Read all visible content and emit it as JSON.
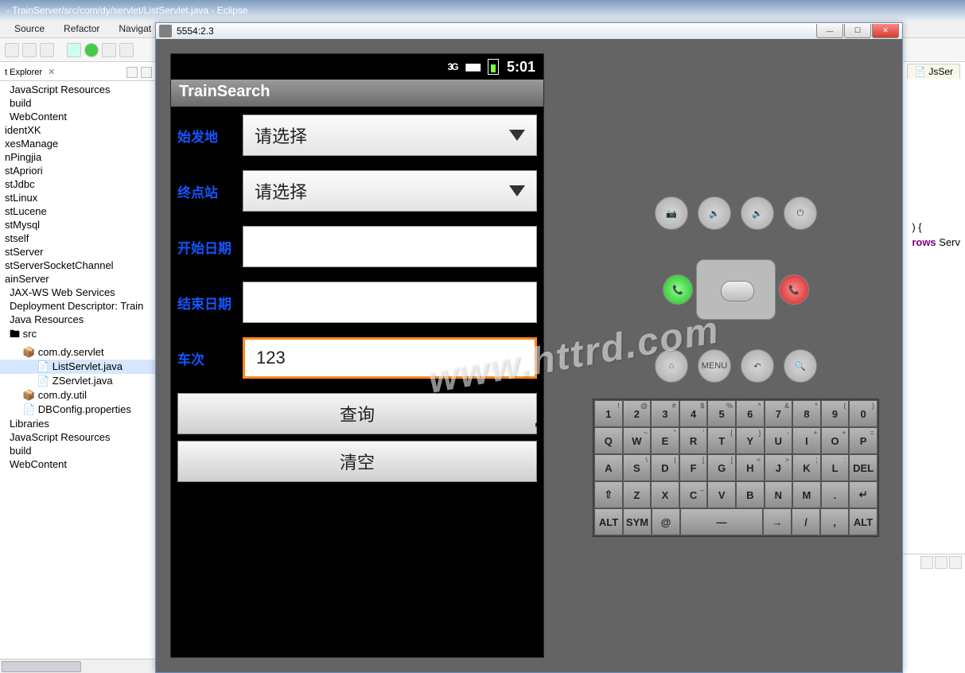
{
  "eclipse": {
    "title": "- TrainServer/src/com/dy/servlet/ListServlet.java - Eclipse",
    "menu": [
      "Source",
      "Refactor",
      "Navigat"
    ],
    "explorer_tab": "t Explorer",
    "editor_tab": "JsSer",
    "code_hint1": ") {",
    "code_hint2_kw": "rows",
    "code_hint2_rest": " Serv",
    "tree": [
      {
        "t": "JavaScript Resources",
        "cls": "in1"
      },
      {
        "t": "build",
        "cls": "in1"
      },
      {
        "t": "WebContent",
        "cls": "in1"
      },
      {
        "t": "identXK",
        "cls": ""
      },
      {
        "t": "xesManage",
        "cls": ""
      },
      {
        "t": "nPingjia",
        "cls": ""
      },
      {
        "t": "stApriori",
        "cls": ""
      },
      {
        "t": "stJdbc",
        "cls": ""
      },
      {
        "t": "stLinux",
        "cls": ""
      },
      {
        "t": "stLucene",
        "cls": ""
      },
      {
        "t": "stMysql",
        "cls": ""
      },
      {
        "t": "stself",
        "cls": ""
      },
      {
        "t": "stServer",
        "cls": ""
      },
      {
        "t": "stServerSocketChannel",
        "cls": ""
      },
      {
        "t": "ainServer",
        "cls": ""
      },
      {
        "t": "JAX-WS Web Services",
        "cls": "in1"
      },
      {
        "t": "Deployment Descriptor: Train",
        "cls": "in1"
      },
      {
        "t": "Java Resources",
        "cls": "in1"
      },
      {
        "t": "🖿 src",
        "cls": "in1"
      },
      {
        "t": "📦 com.dy.servlet",
        "cls": "in2"
      },
      {
        "t": "📄 ListServlet.java",
        "cls": "in3 sel"
      },
      {
        "t": "📄 ZServlet.java",
        "cls": "in3"
      },
      {
        "t": "📦 com.dy.util",
        "cls": "in2"
      },
      {
        "t": "📄 DBConfig.properties",
        "cls": "in2"
      },
      {
        "t": "Libraries",
        "cls": "in1"
      },
      {
        "t": "JavaScript Resources",
        "cls": "in1"
      },
      {
        "t": "build",
        "cls": "in1"
      },
      {
        "t": "WebContent",
        "cls": "in1"
      }
    ]
  },
  "emulator": {
    "title": "5554:2.3",
    "status_time": "5:01",
    "status_net": "3G",
    "app_title": "TrainSearch",
    "rows": {
      "origin_label": "始发地",
      "dest_label": "终点站",
      "start_label": "开始日期",
      "end_label": "结束日期",
      "train_label": "车次"
    },
    "spinner_placeholder": "请选择",
    "train_value": "123",
    "btn_query": "查询",
    "btn_clear": "清空"
  },
  "hw": {
    "row1": [
      "📷",
      "🔉",
      "🔊",
      "⏻"
    ],
    "dpad": {
      "call": "📞",
      "end": "📞"
    },
    "row3": [
      "⌂",
      "MENU",
      "↶",
      "🔍"
    ]
  },
  "keyboard": {
    "r1": [
      {
        "m": "1",
        "a": "!"
      },
      {
        "m": "2",
        "a": "@"
      },
      {
        "m": "3",
        "a": "#"
      },
      {
        "m": "4",
        "a": "$"
      },
      {
        "m": "5",
        "a": "%"
      },
      {
        "m": "6",
        "a": "^"
      },
      {
        "m": "7",
        "a": "&"
      },
      {
        "m": "8",
        "a": "*"
      },
      {
        "m": "9",
        "a": "("
      },
      {
        "m": "0",
        "a": ")"
      }
    ],
    "r2": [
      {
        "m": "Q",
        "a": ""
      },
      {
        "m": "W",
        "a": "~"
      },
      {
        "m": "E",
        "a": "\""
      },
      {
        "m": "R",
        "a": "'"
      },
      {
        "m": "T",
        "a": "{"
      },
      {
        "m": "Y",
        "a": "}"
      },
      {
        "m": "U",
        "a": "-"
      },
      {
        "m": "I",
        "a": "+"
      },
      {
        "m": "O",
        "a": "+"
      },
      {
        "m": "P",
        "a": "="
      }
    ],
    "r3": [
      {
        "m": "A",
        "a": ""
      },
      {
        "m": "S",
        "a": "\\"
      },
      {
        "m": "D",
        "a": "|"
      },
      {
        "m": "F",
        "a": "["
      },
      {
        "m": "G",
        "a": "]"
      },
      {
        "m": "H",
        "a": "<"
      },
      {
        "m": "J",
        "a": ">"
      },
      {
        "m": "K",
        "a": ";"
      },
      {
        "m": "L",
        "a": ":"
      },
      {
        "m": "DEL",
        "a": ""
      }
    ],
    "r4": [
      {
        "m": "⇧",
        "a": ""
      },
      {
        "m": "Z",
        "a": ""
      },
      {
        "m": "X",
        "a": ""
      },
      {
        "m": "C",
        "a": "_"
      },
      {
        "m": "V",
        "a": ""
      },
      {
        "m": "B",
        "a": ""
      },
      {
        "m": "N",
        "a": ""
      },
      {
        "m": "M",
        "a": ""
      },
      {
        "m": ".",
        "a": ""
      },
      {
        "m": "↵",
        "a": ""
      }
    ],
    "r5": [
      {
        "m": "ALT",
        "a": "",
        "w": 1
      },
      {
        "m": "SYM",
        "a": "",
        "w": 1
      },
      {
        "m": "@",
        "a": "",
        "w": 1
      },
      {
        "m": "—",
        "a": "",
        "w": 3
      },
      {
        "m": "→",
        "a": "",
        "w": 1
      },
      {
        "m": "/",
        "a": "",
        "w": 1
      },
      {
        "m": ",",
        "a": "",
        "w": 1
      },
      {
        "m": "ALT",
        "a": "",
        "w": 1
      }
    ]
  },
  "watermark": "www.httrd.com"
}
